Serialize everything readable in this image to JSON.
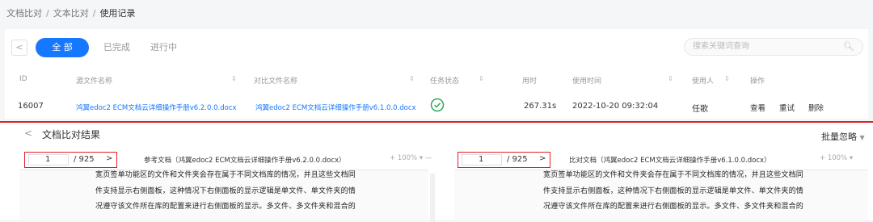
{
  "breadcrumb": {
    "item1": "文档比对",
    "item2": "文本比对",
    "item3": "使用记录",
    "sep": "/"
  },
  "toolbar": {
    "back_icon": "chevron-left-icon",
    "tab_all": "全 部",
    "tab_done": "已完成",
    "tab_progress": "进行中",
    "search_placeholder": "搜索关键词查询",
    "search_icon": "search-icon"
  },
  "table": {
    "headers": {
      "id": "ID",
      "source": "源文件名称",
      "compare": "对比文件名称",
      "status": "任务状态",
      "duration": "用时",
      "time": "使用时间",
      "user": "使用人",
      "ops": "操作"
    },
    "row": {
      "id": "16007",
      "source": "鸿翼edoc2 ECM文档云详细操作手册v6.2.0.0.docx",
      "compare": "鸿翼edoc2 ECM文档云详细操作手册v6.1.0.0.docx",
      "duration": "267.31s",
      "time": "2022-10-20 09:32:04",
      "user": "任歌",
      "op_view": "查看",
      "op_retry": "重试",
      "op_delete": "删除"
    }
  },
  "result": {
    "title": "文档比对结果",
    "batch": "批量忽略",
    "left": {
      "page": "1",
      "total": "/ 925",
      "next": ">",
      "prev": "<",
      "label": "参考文档（鸿翼edoc2 ECM文档云详细操作手册v6.2.0.0.docx）",
      "zoom": "100%"
    },
    "right": {
      "page": "1",
      "total": "/ 925",
      "next": ">",
      "label": "比对文档（鸿翼edoc2 ECM文档云详细操作手册v6.1.0.0.docx）",
      "zoom": "100%"
    },
    "lines": [
      "宽页签单功能区的文件和文件夹会存在属于不同文档库的情况，并且这些文档同",
      "件支持显示右侧面板，这种情况下右侧面板的显示逻辑是单文件、单文件夹的情",
      "况遵守该文件所在库的配置来进行右侧面板的显示。多文件、多文件夹和混合的"
    ]
  }
}
